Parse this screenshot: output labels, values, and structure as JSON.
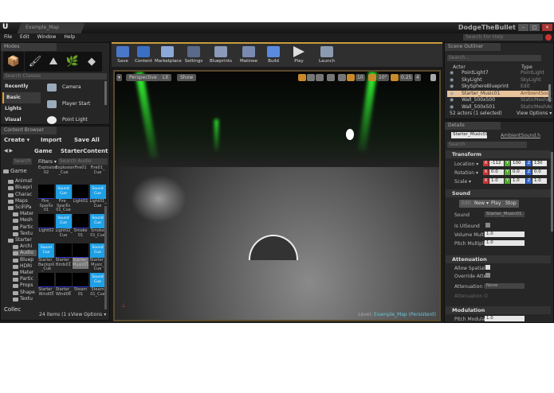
{
  "window": {
    "logo": "U",
    "tab": "Example_Map",
    "project": "DodgeTheBullet",
    "minimize": "–",
    "maximize": "□",
    "close": "✕"
  },
  "menu": [
    "File",
    "Edit",
    "Window",
    "Help"
  ],
  "help_search": {
    "placeholder": "Search For Help"
  },
  "modes": {
    "tab": "Modes",
    "icons": [
      "place-mode-icon",
      "paint-mode-icon",
      "landscape-mode-icon",
      "foliage-mode-icon",
      "geometry-mode-icon"
    ],
    "search_placeholder": "Search Classes",
    "categories": [
      "Recently Placed",
      "Basic",
      "Lights",
      "Visual"
    ],
    "selected_category": "Basic",
    "items": [
      "Camera",
      "Player Start",
      "Point Light"
    ]
  },
  "toolbar": [
    "Save",
    "Content",
    "Marketplace",
    "Settings",
    "Blueprints",
    "Matinee",
    "Build",
    "Play",
    "Launch"
  ],
  "viewport": {
    "view_mode": "Perspective",
    "lighting": "Lit",
    "show": "Show",
    "grid_snap": "10",
    "rot_snap": "10°",
    "scale_snap": "0.25",
    "camera_speed": "4",
    "level_label": "Level:",
    "level_name": "Example_Map (Persistent)"
  },
  "outliner": {
    "tab": "Scene Outliner",
    "search_placeholder": "Search...",
    "col_actor": "Actor",
    "col_type": "Type",
    "rows": [
      {
        "actor": "PointLight7",
        "type": "PointLight"
      },
      {
        "actor": "SkyLight",
        "type": "SkyLight"
      },
      {
        "actor": "SkySphereBlueprint",
        "type": "Edit BP_Sky_"
      },
      {
        "actor": "Starter_Music01",
        "type": "AmbientSoun"
      },
      {
        "actor": "Wall_500x500",
        "type": "StaticMeshAc"
      },
      {
        "actor": "Wall_500x501",
        "type": "StaticMeshAc"
      }
    ],
    "selected": 3,
    "status": "52 actors (1 selected)",
    "view_options": "View Options ▾"
  },
  "details": {
    "tab": "Details",
    "name": "Starter_Music01",
    "class_link": "AmbientSound.h",
    "search_placeholder": "Search",
    "transform": {
      "title": "Transform",
      "location_label": "Location ▾",
      "rotation_label": "Rotation ▾",
      "scale_label": "Scale ▾",
      "location": [
        "-112",
        "100",
        "130"
      ],
      "rotation": [
        "0.0",
        "0.0",
        "0.0"
      ],
      "scale": [
        "1.0",
        "1.0",
        "1.0"
      ],
      "axes": [
        "X",
        "Y",
        "Z"
      ]
    },
    "sound": {
      "title": "Sound",
      "edit": "Edit",
      "new": "New ▾",
      "play": "Play",
      "stop": "Stop",
      "sound_label": "Sound",
      "sound_value": "Starter_Music01",
      "is_ui_label": "Is UISound",
      "volume_label": "Volume Multip",
      "volume": "1.0",
      "pitch_label": "Pitch Multiplie",
      "pitch": "1.0"
    },
    "attenuation": {
      "title": "Attenuation",
      "allow_spatial": "Allow Spatiali",
      "override": "Override Atten",
      "settings_label": "Attenuation S",
      "settings_value": "None",
      "overrides": "Attenuation O"
    },
    "modulation": {
      "title": "Modulation",
      "pitch_label": "Pitch Modulat",
      "pitch": "1.0"
    }
  },
  "content_browser": {
    "tab": "Content Browser",
    "create": "Create ▾",
    "import": "Import",
    "save_all": "Save All",
    "path": [
      "Game",
      "StarterContent"
    ],
    "tree_search": "Search",
    "filters": "Filters ▾",
    "search_placeholder": "Search Audio",
    "tree": [
      "Game",
      "Animat",
      "Bluepri",
      "Charac",
      "Maps",
      "SciFiPa",
      "Mater",
      "Mesh",
      "Partic",
      "Textu",
      "Starter",
      "Archi",
      "Audio",
      "Bluep",
      "HDRI",
      "Mater",
      "Partic",
      "Props",
      "Shape",
      "Textu"
    ],
    "assets": [
      {
        "name": "Explosion 02",
        "cue": false
      },
      {
        "name": "Explosion _Cue",
        "cue": true
      },
      {
        "name": "Fire01",
        "cue": false
      },
      {
        "name": "Fire01_ Cue",
        "cue": true
      },
      {
        "name": "Fire_ Sparks 01",
        "cue": false
      },
      {
        "name": "Fire_ Sparks 01_Cue",
        "cue": true
      },
      {
        "name": "Light01",
        "cue": false
      },
      {
        "name": "Light01_ Cue",
        "cue": true
      },
      {
        "name": "Light02",
        "cue": false
      },
      {
        "name": "Light02_ Cue",
        "cue": true
      },
      {
        "name": "Smoke 01",
        "cue": false
      },
      {
        "name": "Smoke 01_Cue",
        "cue": true
      },
      {
        "name": "Starter_ Backgro _Cue",
        "cue": true
      },
      {
        "name": "Starter_ Birds01",
        "cue": false
      },
      {
        "name": "Starter_ Music01",
        "cue": false
      },
      {
        "name": "Starter_ Music_ Cue",
        "cue": true
      },
      {
        "name": "Starter_ Wind05",
        "cue": false
      },
      {
        "name": "Starter_ Wind06",
        "cue": false
      },
      {
        "name": "Steam 01",
        "cue": false
      },
      {
        "name": "Steam 01_Cue",
        "cue": true
      }
    ],
    "sound_cue_label": "Sound Cue",
    "status": "24 items (1 s",
    "view_options": "View Options ▾",
    "collections": "Collec"
  }
}
